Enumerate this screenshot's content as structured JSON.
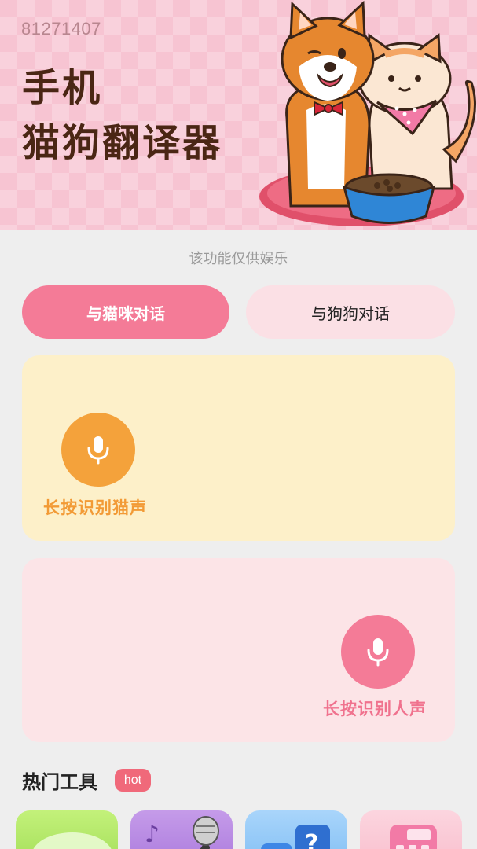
{
  "banner": {
    "id_text": "81271407",
    "title_line1": "手机",
    "title_line2": "猫狗翻译器"
  },
  "notice": "该功能仅供娱乐",
  "tabs": {
    "cat": "与猫咪对话",
    "dog": "与狗狗对话",
    "active": "cat"
  },
  "cat_card": {
    "label": "长按识别猫声",
    "icon": "microphone-icon"
  },
  "human_card": {
    "label": "长按识别人声",
    "icon": "microphone-icon"
  },
  "hot_tools": {
    "title": "热门工具",
    "badge": "hot",
    "items": [
      {
        "icon": "chat-bubble-icon"
      },
      {
        "icon": "music-microphone-icon"
      },
      {
        "icon": "question-blocks-icon"
      },
      {
        "icon": "calculator-icon"
      }
    ]
  },
  "colors": {
    "accent_pink": "#f47b97",
    "accent_orange": "#f4a23b",
    "cat_card_bg": "#fdf0c9",
    "human_card_bg": "#fce4e7",
    "banner_bg": "#f7c4d2"
  }
}
